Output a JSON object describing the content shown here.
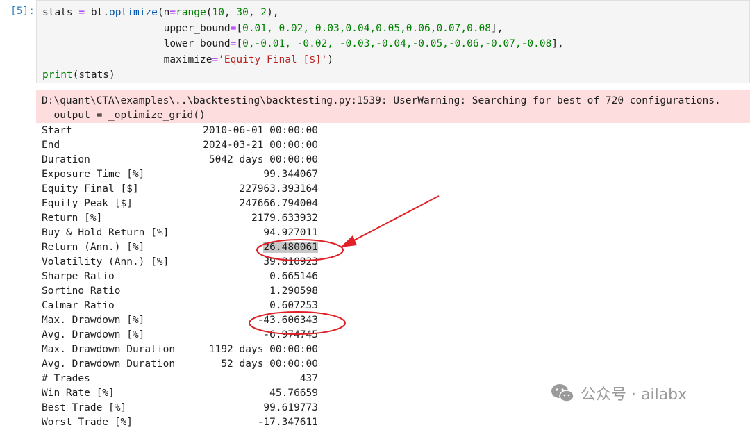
{
  "cell": {
    "prompt": "[5]:",
    "code_lines": {
      "l1_a": "stats ",
      "l1_eq": "=",
      "l1_b": " bt.",
      "l1_fn": "optimize",
      "l1_c": "(n",
      "l1_eq2": "=",
      "l1_fn2": "range",
      "l1_d": "(",
      "l1_n1": "10",
      "l1_e": ", ",
      "l1_n2": "30",
      "l1_f": ", ",
      "l1_n3": "2",
      "l1_g": "),",
      "l2_a": "                    upper_bound",
      "l2_eq": "=",
      "l2_b": "[",
      "l2_vals": "0.01, 0.02, 0.03,0.04,0.05,0.06,0.07,0.08",
      "l2_c": "],",
      "l3_a": "                    lower_bound",
      "l3_eq": "=",
      "l3_b": "[",
      "l3_vals": "0,-0.01, -0.02, -0.03,-0.04,-0.05,-0.06,-0.07,-0.08",
      "l3_c": "],",
      "l4_a": "                    maximize",
      "l4_eq": "=",
      "l4_str": "'Equity Final [$]'",
      "l4_c": ")",
      "l5_fn": "print",
      "l5_c": "(stats)"
    }
  },
  "stderr": {
    "line1": "D:\\quant\\CTA\\examples\\..\\backtesting\\backtesting.py:1539: UserWarning: Searching for best of 720 configurations.",
    "line2": "  output = _optimize_grid()"
  },
  "stats": [
    {
      "key": "Start",
      "value": "2010-06-01 00:00:00"
    },
    {
      "key": "End",
      "value": "2024-03-21 00:00:00"
    },
    {
      "key": "Duration",
      "value": "5042 days 00:00:00"
    },
    {
      "key": "Exposure Time [%]",
      "value": "99.344067"
    },
    {
      "key": "Equity Final [$]",
      "value": "227963.393164"
    },
    {
      "key": "Equity Peak [$]",
      "value": "247666.794004"
    },
    {
      "key": "Return [%]",
      "value": "2179.633932"
    },
    {
      "key": "Buy & Hold Return [%]",
      "value": "94.927011"
    },
    {
      "key": "Return (Ann.) [%]",
      "value": "26.480061"
    },
    {
      "key": "Volatility (Ann.) [%]",
      "value": "39.810923"
    },
    {
      "key": "Sharpe Ratio",
      "value": "0.665146"
    },
    {
      "key": "Sortino Ratio",
      "value": "1.290598"
    },
    {
      "key": "Calmar Ratio",
      "value": "0.607253"
    },
    {
      "key": "Max. Drawdown [%]",
      "value": "-43.606343"
    },
    {
      "key": "Avg. Drawdown [%]",
      "value": "-6.974745"
    },
    {
      "key": "Max. Drawdown Duration",
      "value": "1192 days 00:00:00"
    },
    {
      "key": "Avg. Drawdown Duration",
      "value": "52 days 00:00:00"
    },
    {
      "key": "# Trades",
      "value": "437"
    },
    {
      "key": "Win Rate [%]",
      "value": "45.76659"
    },
    {
      "key": "Best Trade [%]",
      "value": "99.619773"
    },
    {
      "key": "Worst Trade [%]",
      "value": "-17.347611"
    }
  ],
  "watermark": {
    "text": "公众号 · ailabx",
    "icon": "wechat-icon"
  },
  "colors": {
    "prompt": "#307fc1",
    "stderr_bg": "#fddddd",
    "annotation": "#e01f26"
  }
}
